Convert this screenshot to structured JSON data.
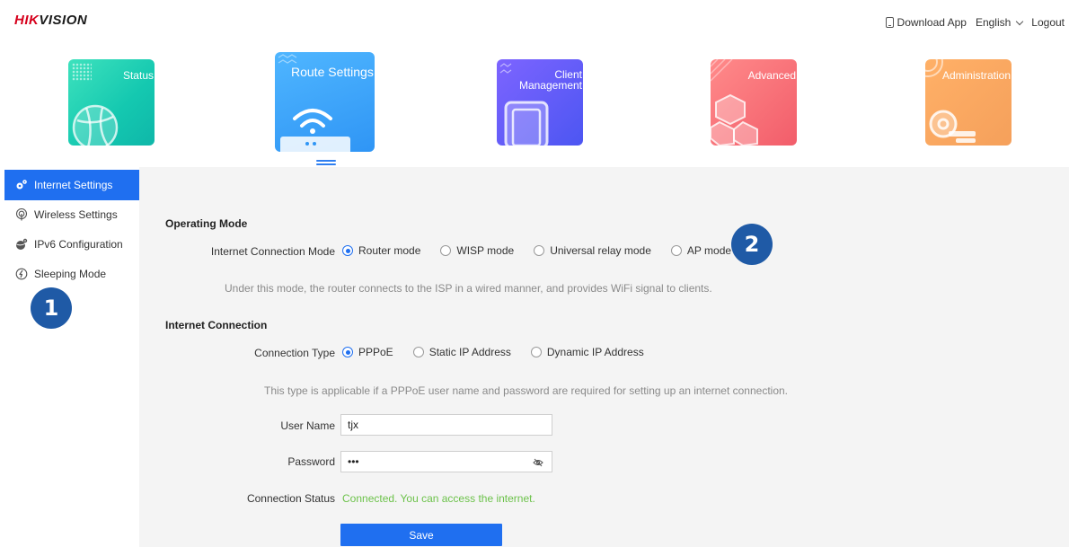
{
  "header": {
    "brand_red": "HIK",
    "brand_black": "VISION",
    "download_app": "Download App",
    "language": "English",
    "logout": "Logout"
  },
  "tiles": {
    "status": "Status",
    "route": "Route Settings",
    "client_line1": "Client",
    "client_line2": "Management",
    "advanced": "Advanced",
    "administration": "Administration"
  },
  "sidebar": {
    "items": [
      {
        "label": "Internet Settings",
        "icon": "gears-icon",
        "active": true
      },
      {
        "label": "Wireless Settings",
        "icon": "antenna-icon",
        "active": false
      },
      {
        "label": "IPv6 Configuration",
        "icon": "globe-gear-icon",
        "active": false
      },
      {
        "label": "Sleeping Mode",
        "icon": "power-icon",
        "active": false
      }
    ]
  },
  "badges": {
    "one": "1",
    "two": "2"
  },
  "operating_mode": {
    "title": "Operating Mode",
    "label": "Internet Connection Mode",
    "options": [
      "Router mode",
      "WISP mode",
      "Universal relay mode",
      "AP mode"
    ],
    "selected": "Router mode",
    "hint": "Under this mode, the router connects to the ISP in a wired manner, and provides WiFi signal to clients."
  },
  "internet_connection": {
    "title": "Internet Connection",
    "type_label": "Connection Type",
    "types": [
      "PPPoE",
      "Static IP Address",
      "Dynamic IP Address"
    ],
    "selected": "PPPoE",
    "hint": "This type is applicable if a PPPoE user name and password are required for setting up an internet connection.",
    "username_label": "User Name",
    "username_value": "tjx",
    "password_label": "Password",
    "password_value": "•••",
    "status_label": "Connection Status",
    "status_value": "Connected. You can access the internet.",
    "save_label": "Save"
  },
  "colors": {
    "accent": "#1f6ff0",
    "success": "#6cc24a",
    "brand_red": "#d6001c",
    "badge": "#1f5aa6"
  }
}
